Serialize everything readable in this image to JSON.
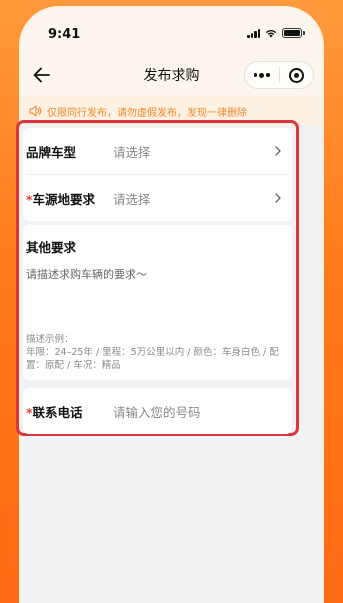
{
  "status_bar": {
    "time": "9:41"
  },
  "nav": {
    "title": "发布求购"
  },
  "notice": {
    "text": "仅限同行发布，请勿虚假发布，发现一律删除"
  },
  "form": {
    "brand": {
      "label": "品牌车型",
      "value": "请选择"
    },
    "source": {
      "required_mark": "*",
      "label": "车源地要求",
      "value": "请选择"
    },
    "other": {
      "title": "其他要求",
      "placeholder": "请描述求购车辆的要求～",
      "example_title": "描述示例：",
      "example_line1": "年限：24–25年 / 里程：5万公里以内 / 颜色：车身白色 / 配",
      "example_line2": "置：原配 / 车况：精品"
    },
    "phone": {
      "required_mark": "*",
      "label": "联系电话",
      "placeholder": "请输入您的号码"
    }
  },
  "colors": {
    "accent": "#ff7a1a",
    "highlight_border": "#d9363e",
    "required": "#e8423f",
    "notice_text": "#f18a2e"
  }
}
